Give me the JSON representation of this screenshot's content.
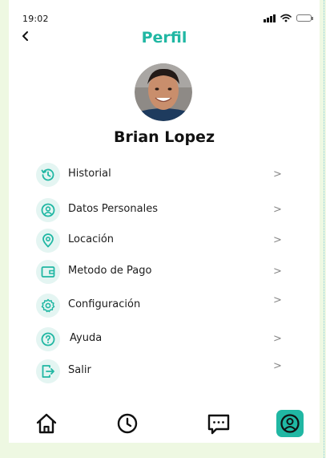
{
  "status_bar": {
    "time": "19:02"
  },
  "header": {
    "back_label": "<",
    "title": "Perfil"
  },
  "profile": {
    "name": "Brian Lopez"
  },
  "menu": {
    "items": [
      {
        "label": "Historial",
        "icon": "history-icon",
        "chevron": ">"
      },
      {
        "label": "Datos Personales",
        "icon": "user-icon",
        "chevron": ">"
      },
      {
        "label": "Locación",
        "icon": "location-pin-icon",
        "chevron": ">"
      },
      {
        "label": "Metodo de Pago",
        "icon": "wallet-icon",
        "chevron": ">"
      },
      {
        "label": "Configuración",
        "icon": "gear-icon",
        "chevron": ">"
      },
      {
        "label": "Ayuda",
        "icon": "help-icon",
        "chevron": ">"
      },
      {
        "label": "Salir",
        "icon": "logout-icon",
        "chevron": ">"
      }
    ]
  },
  "tab_bar": {
    "tabs": [
      {
        "icon": "home-icon",
        "active": false
      },
      {
        "icon": "clock-icon",
        "active": false
      },
      {
        "icon": "chat-icon",
        "active": false
      },
      {
        "icon": "profile-icon",
        "active": true
      }
    ]
  },
  "colors": {
    "accent": "#20b7a3",
    "icon_background": "#e4f5f2",
    "page_background": "#eef8e2"
  }
}
